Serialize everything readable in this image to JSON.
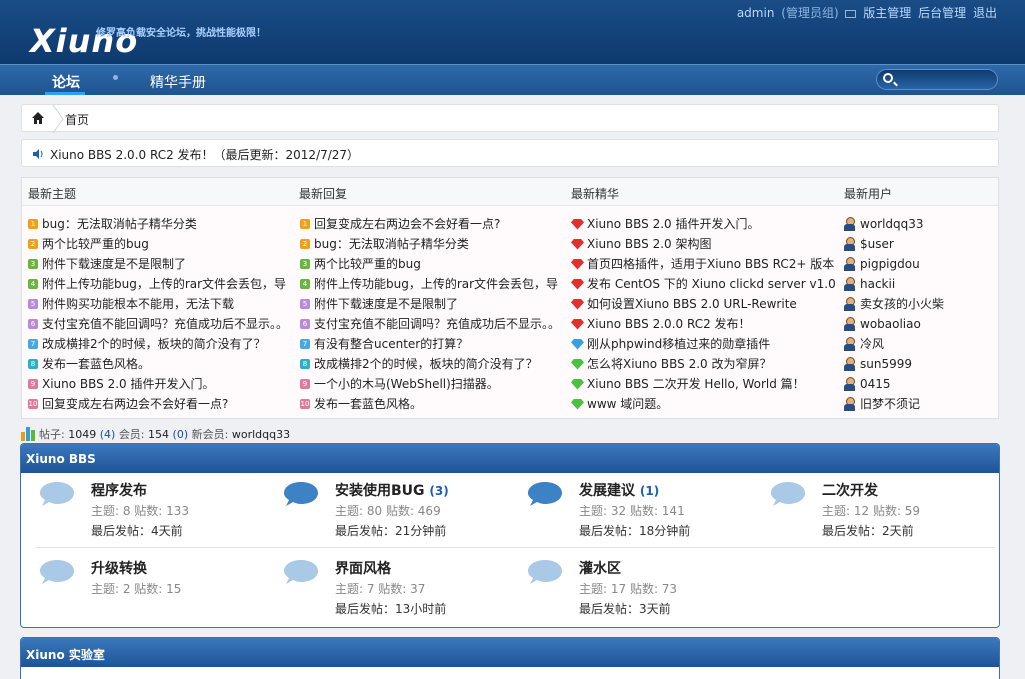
{
  "header": {
    "logo": "Xiuno",
    "slogan": "修罗高负载安全论坛，挑战性能极限！",
    "user": "admin",
    "role": "(管理员组)",
    "admin_link": "版主管理",
    "backend_link": "后台管理",
    "logout_link": "退出"
  },
  "nav": {
    "items": [
      "论坛",
      "精华手册"
    ],
    "search_placeholder": ""
  },
  "breadcrumb": {
    "home": "首页"
  },
  "notice": {
    "text": "Xiuno BBS 2.0.0 RC2 发布！（最后更新：2012/7/27）"
  },
  "latest": {
    "columns": [
      "最新主题",
      "最新回复",
      "最新精华",
      "最新用户"
    ],
    "topics": [
      "bug：无法取消帖子精华分类",
      "两个比较严重的bug",
      "附件下载速度是不是限制了",
      "附件上传功能bug，上传的rar文件会丢包，导",
      "附件购买功能根本不能用，无法下载",
      "支付宝充值不能回调吗？充值成功后不显示。。",
      "改成横排2个的时候，板块的简介没有了？",
      "发布一套蓝色风格。",
      "Xiuno BBS 2.0 插件开发入门。",
      "回复变成左右两边会不会好看一点?"
    ],
    "replies": [
      "回复变成左右两边会不会好看一点?",
      "bug：无法取消帖子精华分类",
      "两个比较严重的bug",
      "附件上传功能bug，上传的rar文件会丢包，导",
      "附件下载速度是不是限制了",
      "支付宝充值不能回调吗？充值成功后不显示。。",
      "有没有整合ucenter的打算？",
      "改成横排2个的时候，板块的简介没有了？",
      "一个小的木马(WebShell)扫描器。",
      "发布一套蓝色风格。"
    ],
    "digests": [
      "Xiuno BBS 2.0 插件开发入门。",
      "Xiuno BBS 2.0 架构图",
      "首页四格插件，适用于Xiuno BBS RC2+ 版本",
      "发布 CentOS 下的 Xiuno clickd server v1.0",
      "如何设置Xiuno BBS 2.0 URL-Rewrite",
      "Xiuno BBS 2.0.0 RC2 发布！",
      "刚从phpwind移植过来的勋章插件",
      "怎么将Xiuno BBS 2.0 改为窄屏？",
      "Xiuno BBS 二次开发 Hello, World 篇！",
      "www 域问题。"
    ],
    "users": [
      "worldqq33",
      "$user",
      "pigpigdou",
      "hackii",
      "卖女孩的小火柴",
      "wobaoliao",
      "冷风",
      "sun5999",
      "0415",
      "旧梦不须记"
    ]
  },
  "stats": {
    "posts_label": "帖子:",
    "posts": "1049",
    "posts_today": "(4)",
    "members_label": "会员:",
    "members": "154",
    "members_today": "(0)",
    "newest_label": "新会员:",
    "newest": "worldqq33"
  },
  "sections": [
    {
      "title": "Xiuno BBS",
      "forums": [
        {
          "name": "程序发布",
          "badge": "",
          "stats": "主题: 8 贴数: 133",
          "last": "最后发帖：4天前"
        },
        {
          "name": "安装使用BUG",
          "badge": "(3)",
          "stats": "主题: 80 贴数: 469",
          "last": "最后发帖：21分钟前"
        },
        {
          "name": "发展建议",
          "badge": "(1)",
          "stats": "主题: 32 贴数: 141",
          "last": "最后发帖：18分钟前"
        },
        {
          "name": "二次开发",
          "badge": "",
          "stats": "主题: 12 贴数: 59",
          "last": "最后发帖：2天前"
        },
        {
          "name": "升级转换",
          "badge": "",
          "stats": "主题: 2 贴数: 15",
          "last": ""
        },
        {
          "name": "界面风格",
          "badge": "",
          "stats": "主题: 7 贴数: 37",
          "last": "最后发帖：13小时前"
        },
        {
          "name": "灌水区",
          "badge": "",
          "stats": "主题: 17 贴数: 73",
          "last": "最后发帖：3天前"
        }
      ]
    },
    {
      "title": "Xiuno 实验室"
    }
  ],
  "colors": {
    "header_bg": "#164a85",
    "nav_bg": "#2a63a2",
    "accent": "#2ba0ff",
    "rank": [
      "#f0a020",
      "#f0a020",
      "#6ab540",
      "#6ab540",
      "#b98adc",
      "#b98adc",
      "#4aa8e0",
      "#2cb0c8",
      "#e07a9a",
      "#e07a9a"
    ],
    "rank_numbers": [
      "1",
      "2",
      "3",
      "4",
      "5",
      "6",
      "7",
      "8",
      "9",
      "10"
    ],
    "gem": [
      "#e03030",
      "#e03030",
      "#e03030",
      "#e03030",
      "#e03030",
      "#e03030",
      "#3aa0e0",
      "#4cc040",
      "#4cc040",
      "#4cc040"
    ],
    "gem_names": [
      "red-gem-icon",
      "red-gem-icon",
      "red-gem-icon",
      "red-gem-icon",
      "red-gem-icon",
      "red-gem-icon",
      "blue-gem-icon",
      "green-gem-icon",
      "green-gem-icon",
      "green-gem-icon"
    ]
  }
}
